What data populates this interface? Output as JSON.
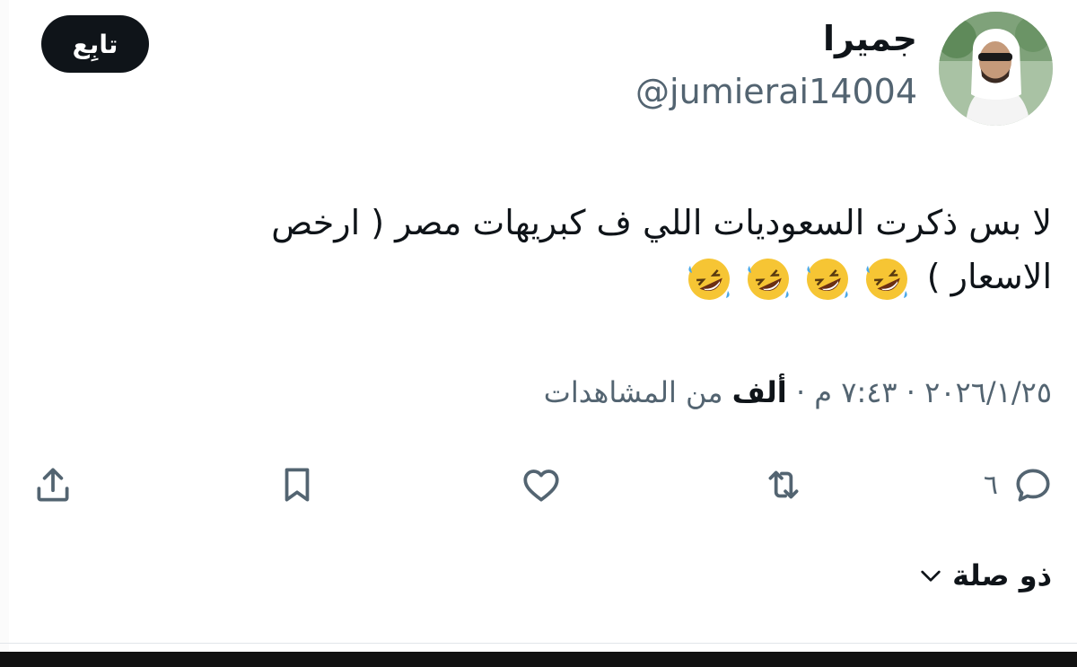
{
  "user": {
    "display_name": "جميرا",
    "handle": "@jumierai14004"
  },
  "follow_button": {
    "label": "تابِع"
  },
  "tweet": {
    "line1": "لا بس ذكرت السعوديات اللي ف كبريهات مصر ( ارخص",
    "line2": "الاسعار )",
    "emoji": [
      "rolling-on-floor-laughing",
      "rolling-on-floor-laughing",
      "rolling-on-floor-laughing",
      "rolling-on-floor-laughing"
    ]
  },
  "meta": {
    "date": "٢٠٢٦/١/٢٥",
    "separator": "·",
    "time": "٧:٤٣ م",
    "views_count": "ألف",
    "views_suffix": "من المشاهدات"
  },
  "actions": {
    "reply_count": "٦"
  },
  "related": {
    "label": "ذو صلة"
  },
  "colors": {
    "text": "#0f1419",
    "secondary": "#536471",
    "button_bg": "#0f1419"
  }
}
